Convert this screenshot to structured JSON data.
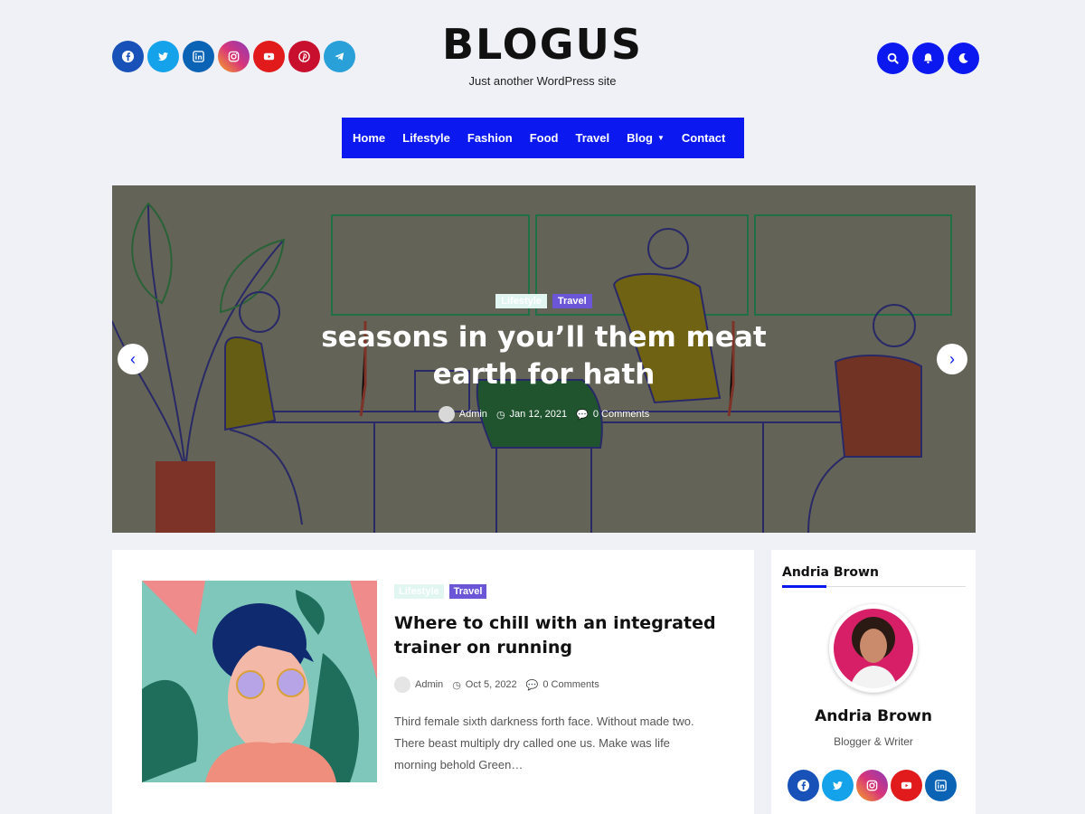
{
  "site": {
    "title": "BLOGUS",
    "tagline": "Just another WordPress site"
  },
  "header_social": [
    {
      "icon": "facebook-icon",
      "color": "#1852b8"
    },
    {
      "icon": "twitter-icon",
      "color": "#14a2ea"
    },
    {
      "icon": "linkedin-icon",
      "color": "#0b63b5"
    },
    {
      "icon": "instagram-icon",
      "color": "#d8357a"
    },
    {
      "icon": "youtube-icon",
      "color": "#e11b1b"
    },
    {
      "icon": "pinterest-icon",
      "color": "#c8102e"
    },
    {
      "icon": "telegram-icon",
      "color": "#2aa0d9"
    }
  ],
  "header_actions": [
    "search-icon",
    "bell-icon",
    "moon-icon"
  ],
  "nav": {
    "items": [
      "Home",
      "Lifestyle",
      "Fashion",
      "Food",
      "Travel",
      "Blog",
      "Contact"
    ],
    "accent": "#0b19f0"
  },
  "hero": {
    "categories": [
      "Lifestyle",
      "Travel"
    ],
    "title_line1": "seasons in you’ll them meat",
    "title_line2": "earth for hath",
    "author": "Admin",
    "date": "Jan 12, 2021",
    "comments": "0 Comments"
  },
  "post": {
    "categories": [
      "Lifestyle",
      "Travel"
    ],
    "title_line1": "Where to chill with an integrated",
    "title_line2": "trainer on running",
    "author": "Admin",
    "date": "Oct 5, 2022",
    "comments": "0 Comments",
    "excerpt_line1": "Third female sixth darkness forth face. Without made two.",
    "excerpt_line2": "There beast multiply dry called one us. Make was life",
    "excerpt_line3": "morning behold Green…"
  },
  "sidebar": {
    "widget_title": "Andria Brown",
    "name": "Andria Brown",
    "role": "Blogger & Writer",
    "social": [
      {
        "icon": "facebook-icon",
        "color": "#1852b8"
      },
      {
        "icon": "twitter-icon",
        "color": "#14a2ea"
      },
      {
        "icon": "instagram-icon",
        "color": "#d8357a"
      },
      {
        "icon": "youtube-icon",
        "color": "#e11b1b"
      },
      {
        "icon": "linkedin-icon",
        "color": "#0b63b5"
      }
    ]
  }
}
